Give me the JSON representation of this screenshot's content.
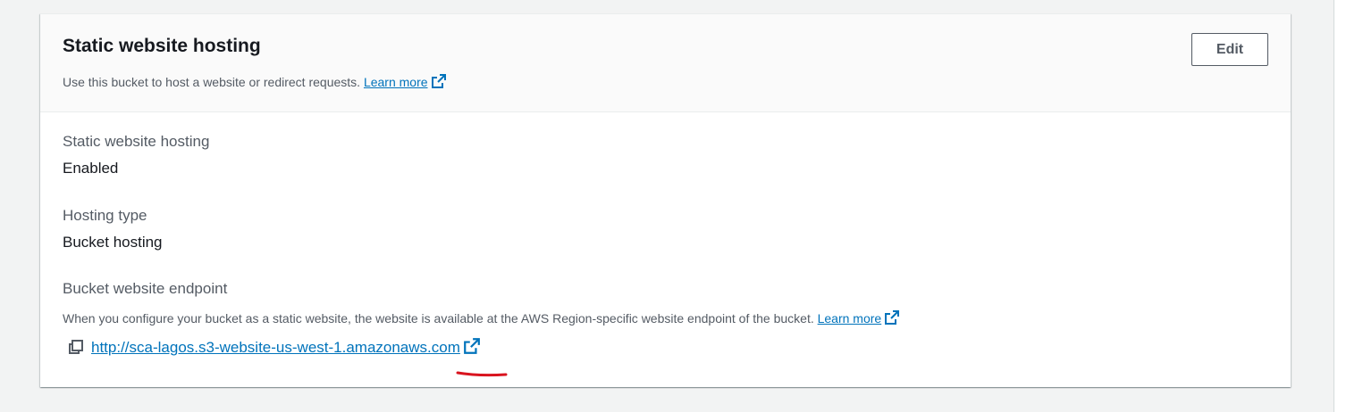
{
  "panel": {
    "title": "Static website hosting",
    "description": "Use this bucket to host a website or redirect requests.",
    "learn_more_label": "Learn more",
    "edit_label": "Edit"
  },
  "fields": {
    "hosting_label": "Static website hosting",
    "hosting_value": "Enabled",
    "type_label": "Hosting type",
    "type_value": "Bucket hosting",
    "endpoint_label": "Bucket website endpoint",
    "endpoint_description": "When you configure your bucket as a static website, the website is available at the AWS Region-specific website endpoint of the bucket.",
    "endpoint_learn_more_label": "Learn more",
    "endpoint_url": "http://sca-lagos.s3-website-us-west-1.amazonaws.com"
  },
  "icons": {
    "external_link": "external-link-icon",
    "copy": "copy-icon"
  },
  "colors": {
    "link": "#0073bb",
    "annotation": "#d9141f",
    "page_bg": "#f2f3f3",
    "header_bg": "#fafafa"
  }
}
